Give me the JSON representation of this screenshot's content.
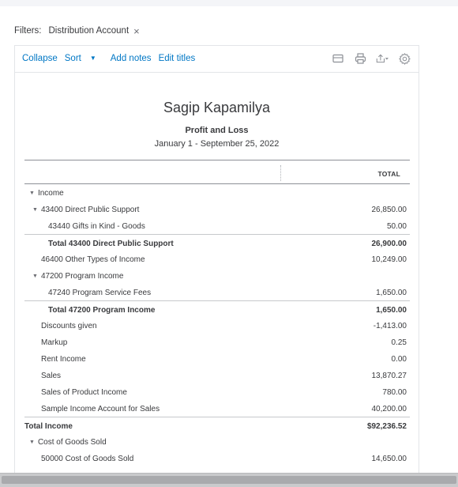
{
  "filters": {
    "label": "Filters:",
    "chip": "Distribution Account",
    "remove_glyph": "×"
  },
  "toolbar": {
    "collapse": "Collapse",
    "sort": "Sort",
    "add_notes": "Add notes",
    "edit_titles": "Edit titles",
    "icons": [
      "email-icon",
      "print-icon",
      "export-icon",
      "settings-icon"
    ]
  },
  "report": {
    "company": "Sagip Kapamilya",
    "title": "Profit and Loss",
    "dates": "January 1 - September 25, 2022",
    "column_header": "TOTAL"
  },
  "rows": [
    {
      "label": "Income",
      "amount": "",
      "indent": 0,
      "toggle": true,
      "bold": false,
      "topline": false
    },
    {
      "label": "43400 Direct Public Support",
      "amount": "26,850.00",
      "indent": 1,
      "toggle": true,
      "bold": false,
      "topline": false
    },
    {
      "label": "43440 Gifts in Kind - Goods",
      "amount": "50.00",
      "indent": 2,
      "toggle": false,
      "bold": false,
      "topline": false
    },
    {
      "label": "Total 43400 Direct Public Support",
      "amount": "26,900.00",
      "indent": 2,
      "toggle": false,
      "bold": true,
      "topline": true
    },
    {
      "label": "46400 Other Types of Income",
      "amount": "10,249.00",
      "indent": 1,
      "toggle": false,
      "bold": false,
      "topline": false
    },
    {
      "label": "47200 Program Income",
      "amount": "",
      "indent": 1,
      "toggle": true,
      "bold": false,
      "topline": false
    },
    {
      "label": "47240 Program Service Fees",
      "amount": "1,650.00",
      "indent": 2,
      "toggle": false,
      "bold": false,
      "topline": false
    },
    {
      "label": "Total 47200 Program Income",
      "amount": "1,650.00",
      "indent": 2,
      "toggle": false,
      "bold": true,
      "topline": true
    },
    {
      "label": "Discounts given",
      "amount": "-1,413.00",
      "indent": 1,
      "toggle": false,
      "bold": false,
      "topline": false
    },
    {
      "label": "Markup",
      "amount": "0.25",
      "indent": 1,
      "toggle": false,
      "bold": false,
      "topline": false
    },
    {
      "label": "Rent Income",
      "amount": "0.00",
      "indent": 1,
      "toggle": false,
      "bold": false,
      "topline": false
    },
    {
      "label": "Sales",
      "amount": "13,870.27",
      "indent": 1,
      "toggle": false,
      "bold": false,
      "topline": false
    },
    {
      "label": "Sales of Product Income",
      "amount": "780.00",
      "indent": 1,
      "toggle": false,
      "bold": false,
      "topline": false
    },
    {
      "label": "Sample Income Account for Sales",
      "amount": "40,200.00",
      "indent": 1,
      "toggle": false,
      "bold": false,
      "topline": false
    },
    {
      "label": "Total Income",
      "amount": "$92,236.52",
      "indent": 0.5,
      "toggle": false,
      "bold": true,
      "topline": true
    },
    {
      "label": "Cost of Goods Sold",
      "amount": "",
      "indent": 0,
      "toggle": true,
      "bold": false,
      "topline": false
    },
    {
      "label": "50000 Cost of Goods Sold",
      "amount": "14,650.00",
      "indent": 1,
      "toggle": false,
      "bold": false,
      "topline": false
    }
  ]
}
